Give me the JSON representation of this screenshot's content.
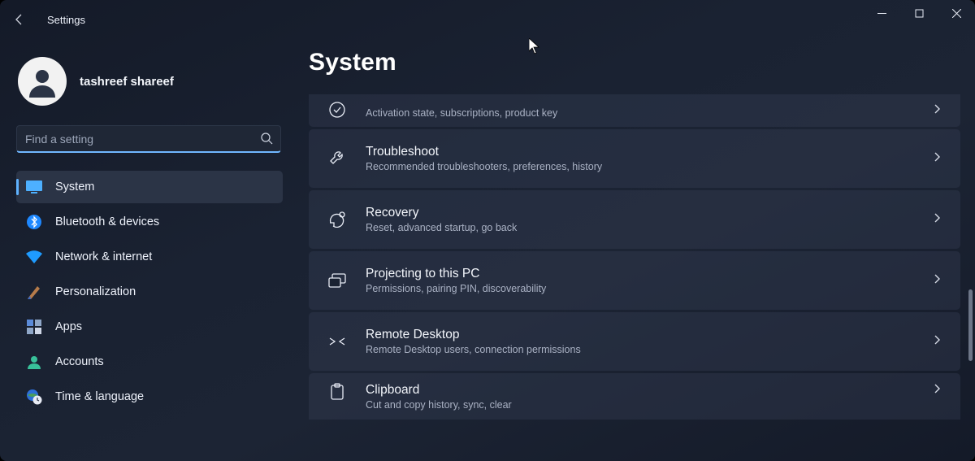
{
  "titlebar": {
    "app_title": "Settings"
  },
  "profile": {
    "username": "tashreef shareef"
  },
  "search": {
    "placeholder": "Find a setting",
    "value": ""
  },
  "sidebar": {
    "items": [
      {
        "key": "system",
        "label": "System",
        "active": true
      },
      {
        "key": "bluetooth",
        "label": "Bluetooth & devices"
      },
      {
        "key": "network",
        "label": "Network & internet"
      },
      {
        "key": "personalization",
        "label": "Personalization"
      },
      {
        "key": "apps",
        "label": "Apps"
      },
      {
        "key": "accounts",
        "label": "Accounts"
      },
      {
        "key": "time",
        "label": "Time & language"
      }
    ]
  },
  "main": {
    "title": "System",
    "cards": [
      {
        "key": "activation",
        "title": "",
        "desc": "Activation state, subscriptions, product key",
        "partial": "top"
      },
      {
        "key": "troubleshoot",
        "title": "Troubleshoot",
        "desc": "Recommended troubleshooters, preferences, history"
      },
      {
        "key": "recovery",
        "title": "Recovery",
        "desc": "Reset, advanced startup, go back"
      },
      {
        "key": "projecting",
        "title": "Projecting to this PC",
        "desc": "Permissions, pairing PIN, discoverability"
      },
      {
        "key": "remote",
        "title": "Remote Desktop",
        "desc": "Remote Desktop users, connection permissions"
      },
      {
        "key": "clipboard",
        "title": "Clipboard",
        "desc": "Cut and copy history, sync, clear",
        "partial": "bottom"
      }
    ]
  }
}
